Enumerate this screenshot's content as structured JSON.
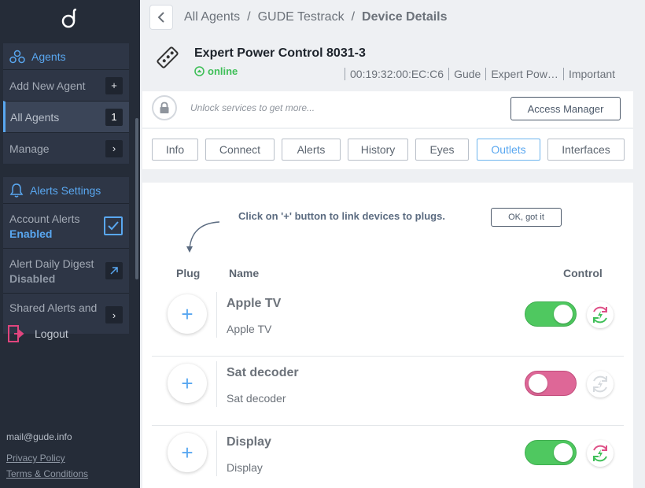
{
  "sidebar": {
    "agents": {
      "title": "Agents",
      "add_label": "Add New Agent",
      "add_button": "+",
      "all_label": "All Agents",
      "all_count": "1",
      "manage_label": "Manage",
      "manage_button": "›"
    },
    "alerts": {
      "title": "Alerts Settings",
      "account_label": "Account Alerts",
      "account_state": "Enabled",
      "digest_label": "Alert Daily Digest",
      "digest_state": "Disabled",
      "shared_label": "Shared Alerts and",
      "shared_button": "›"
    },
    "logout": "Logout",
    "mail": "mail@gude.info",
    "privacy": "Privacy Policy",
    "terms": "Terms & Conditions"
  },
  "breadcrumb": {
    "items": [
      "All Agents",
      "GUDE Testrack",
      "Device Details"
    ],
    "separator": "/"
  },
  "device": {
    "name": "Expert Power Control 8031-3",
    "status": "online",
    "meta": [
      "00:19:32:00:EC:C6",
      "Gude",
      "Expert Pow…",
      "Important"
    ]
  },
  "unlock": {
    "text": "Unlock services to get more...",
    "button": "Access Manager"
  },
  "tabs": [
    {
      "label": "Info"
    },
    {
      "label": "Connect"
    },
    {
      "label": "Alerts"
    },
    {
      "label": "History"
    },
    {
      "label": "Eyes"
    },
    {
      "label": "Outlets"
    },
    {
      "label": "Interfaces"
    }
  ],
  "outlets_panel": {
    "hint": "Click on '+' button to link devices to plugs.",
    "ok_button": "OK, got it",
    "headers": {
      "plug": "Plug",
      "name": "Name",
      "control": "Control"
    },
    "plus": "+",
    "items": [
      {
        "title": "Apple TV",
        "subtitle": "Apple TV",
        "state": "on"
      },
      {
        "title": "Sat decoder",
        "subtitle": "Sat decoder",
        "state": "off"
      },
      {
        "title": "Display",
        "subtitle": "Display",
        "state": "on"
      }
    ]
  },
  "colors": {
    "accent": "#59a7f0",
    "online": "#3fbf58",
    "toggle_on": "#4fc860",
    "toggle_off": "#de6797",
    "sidebar_bg": "#252c38"
  }
}
